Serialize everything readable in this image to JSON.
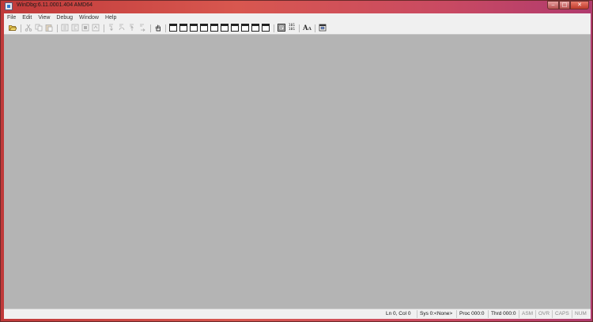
{
  "window": {
    "title": "WinDbg:6.11.0001.404 AMD64",
    "caption_buttons": {
      "minimize": "‒",
      "maximize": "□",
      "close": "✕"
    }
  },
  "menu": [
    "File",
    "Edit",
    "View",
    "Debug",
    "Window",
    "Help"
  ],
  "toolbar": {
    "text_glyphs": {
      "font": "A",
      "font_sub": "A",
      "source_mode": "101"
    },
    "buttons": [
      {
        "name": "open-icon",
        "enabled": true
      },
      {
        "name": "cut-icon",
        "enabled": false
      },
      {
        "name": "copy-icon",
        "enabled": false
      },
      {
        "name": "paste-icon",
        "enabled": false
      },
      {
        "name": "go-icon",
        "enabled": false
      },
      {
        "name": "restart-icon",
        "enabled": false
      },
      {
        "name": "stop-debugging-icon",
        "enabled": false
      },
      {
        "name": "break-icon",
        "enabled": false
      },
      {
        "name": "step-into-icon",
        "enabled": false
      },
      {
        "name": "step-over-icon",
        "enabled": false
      },
      {
        "name": "step-out-icon",
        "enabled": false
      },
      {
        "name": "run-to-cursor-icon",
        "enabled": false
      },
      {
        "name": "hand-icon",
        "enabled": true
      },
      {
        "name": "command-window-icon",
        "enabled": true
      },
      {
        "name": "watch-window-icon",
        "enabled": true
      },
      {
        "name": "locals-window-icon",
        "enabled": true
      },
      {
        "name": "registers-window-icon",
        "enabled": true
      },
      {
        "name": "memory-window-icon",
        "enabled": true
      },
      {
        "name": "call-stack-window-icon",
        "enabled": true
      },
      {
        "name": "disassembly-window-icon",
        "enabled": true
      },
      {
        "name": "scratch-pad-icon",
        "enabled": true
      },
      {
        "name": "processes-threads-icon",
        "enabled": true
      },
      {
        "name": "source-mode-icon",
        "enabled": true
      },
      {
        "name": "font-icon",
        "enabled": true
      },
      {
        "name": "options-icon",
        "enabled": true
      }
    ]
  },
  "status": {
    "ln_col": "Ln 0, Col 0",
    "sys": "Sys 0:<None>",
    "proc": "Proc 000:0",
    "thrd": "Thrd 000:0",
    "asm": "ASM",
    "ovr": "OVR",
    "caps": "CAPS",
    "num": "NUM"
  }
}
